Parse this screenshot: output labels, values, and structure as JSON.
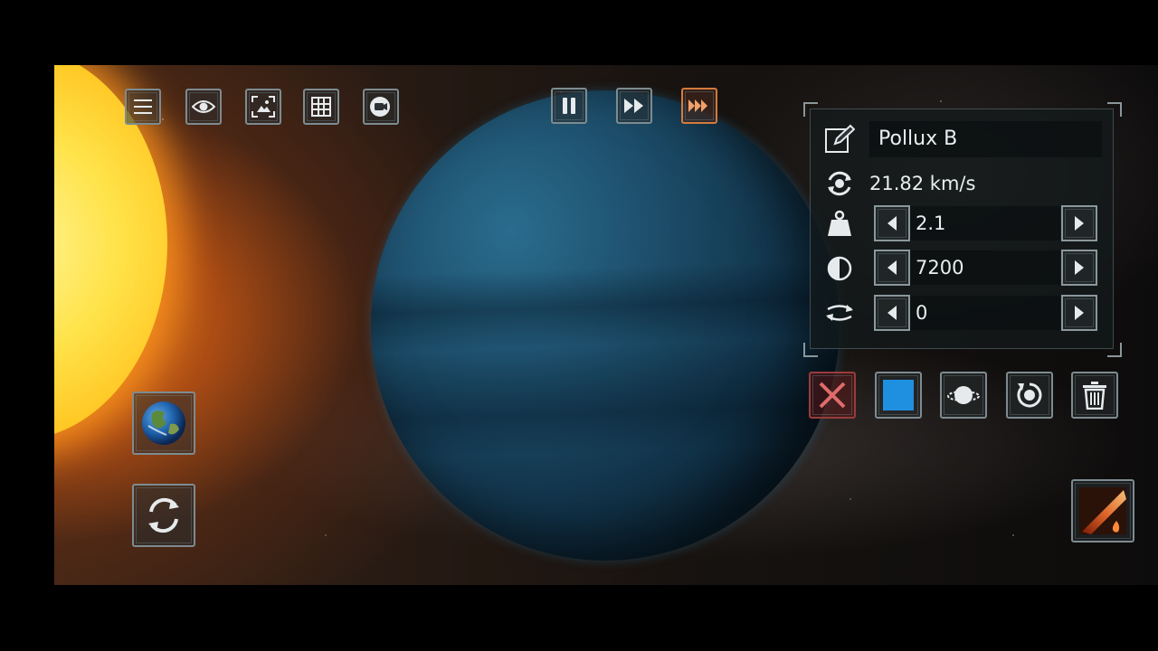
{
  "toolbar": {
    "left_icons": [
      "menu-icon",
      "eye-icon",
      "screenshot-icon",
      "grid-icon",
      "camera-record-icon"
    ],
    "time_controls": [
      "pause-icon",
      "fast-forward-icon",
      "faster-forward-icon"
    ],
    "active_time_control": "faster-forward-icon"
  },
  "object_panel": {
    "name": "Pollux B",
    "speed": "21.82 km/s",
    "mass_value": "2.1",
    "temperature_value": "7200",
    "rotation_value": "0"
  },
  "action_buttons": [
    "close-icon",
    "color-swatch",
    "ring-icon",
    "reset-orbit-icon",
    "trash-icon"
  ],
  "colors": {
    "accent_active": "#d47a3e",
    "button_border": "#7d8b90",
    "color_swatch": "#1f8fe0",
    "close_red": "#e06b6b"
  }
}
